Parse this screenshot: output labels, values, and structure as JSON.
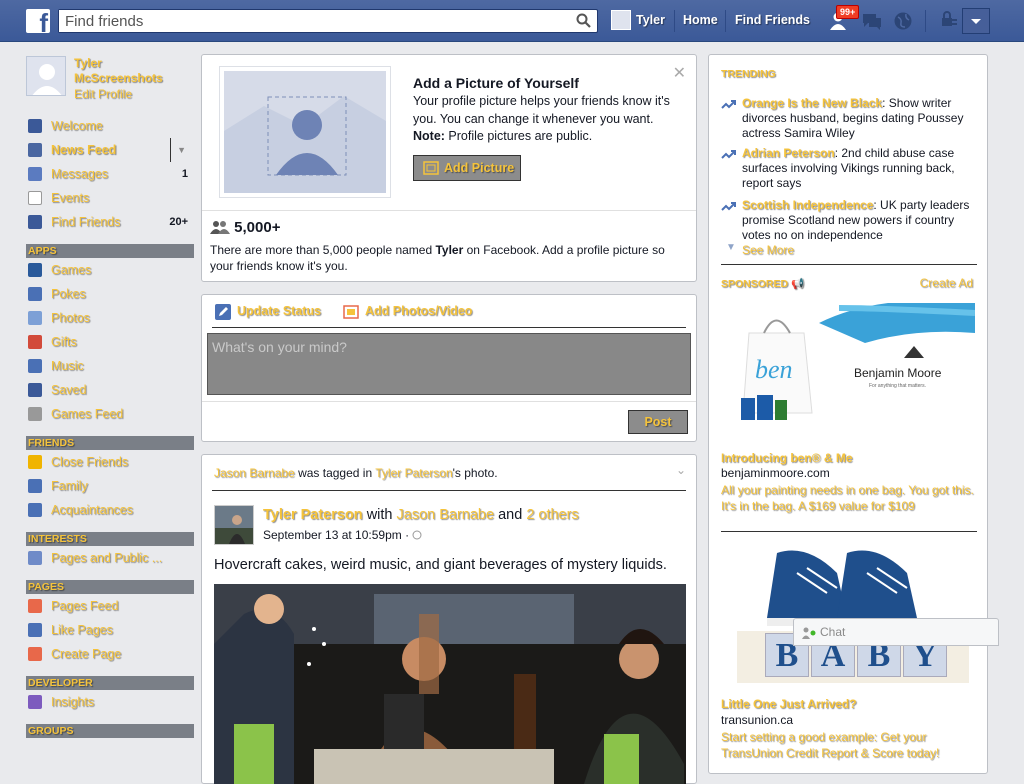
{
  "topbar": {
    "logo": "f",
    "search_placeholder": "Find friends",
    "user_name": "Tyler",
    "home": "Home",
    "find_friends": "Find Friends",
    "notif_badge": "99+",
    "accent": "#3b5998"
  },
  "profile": {
    "name": "Tyler McScreenshots",
    "edit": "Edit Profile"
  },
  "nav": {
    "favorites": [
      {
        "label": "Welcome",
        "icon": "facebook-icon",
        "color": "#3b5998"
      },
      {
        "label": "News Feed",
        "icon": "news-feed-icon",
        "color": "#4b67a1"
      },
      {
        "label": "Messages",
        "icon": "messages-icon",
        "color": "#5b7bc0",
        "count": "1"
      },
      {
        "label": "Events",
        "icon": "calendar-icon",
        "color": "#fff"
      },
      {
        "label": "Find Friends",
        "icon": "find-friends-icon",
        "color": "#3b5998",
        "count": "20+"
      }
    ],
    "apps_header": "APPS",
    "apps": [
      {
        "label": "Games",
        "icon": "games-icon",
        "color": "#2a5a9b"
      },
      {
        "label": "Pokes",
        "icon": "pokes-icon",
        "color": "#4a70b5"
      },
      {
        "label": "Photos",
        "icon": "photos-icon",
        "color": "#7da0d6"
      },
      {
        "label": "Gifts",
        "icon": "gifts-icon",
        "color": "#d24a3a"
      },
      {
        "label": "Music",
        "icon": "music-icon",
        "color": "#4a70b5"
      },
      {
        "label": "Saved",
        "icon": "saved-icon",
        "color": "#3b5998"
      },
      {
        "label": "Games Feed",
        "icon": "gamepad-icon",
        "color": "#999"
      }
    ],
    "friends_header": "FRIENDS",
    "friends": [
      {
        "label": "Close Friends",
        "icon": "star-icon",
        "color": "#f0b400"
      },
      {
        "label": "Family",
        "icon": "family-icon",
        "color": "#4a70b5"
      },
      {
        "label": "Acquaintances",
        "icon": "acquaintances-icon",
        "color": "#4a70b5"
      }
    ],
    "interests_header": "INTERESTS",
    "interests": [
      {
        "label": "Pages and Public ...",
        "icon": "rss-icon",
        "color": "#6f8bc8"
      }
    ],
    "pages_header": "PAGES",
    "pages": [
      {
        "label": "Pages Feed",
        "icon": "megaphone-icon",
        "color": "#e8684a"
      },
      {
        "label": "Like Pages",
        "icon": "thumbs-up-icon",
        "color": "#4a70b5"
      },
      {
        "label": "Create Page",
        "icon": "plus-icon",
        "color": "#e8684a"
      }
    ],
    "developer_header": "DEVELOPER",
    "developer": [
      {
        "label": "Insights",
        "icon": "insights-icon",
        "color": "#7d5bbe"
      }
    ],
    "groups_header": "GROUPS"
  },
  "picture_prompt": {
    "title": "Add a Picture of Yourself",
    "text": "Your profile picture helps your friends know it's you. You can change it whenever you want.",
    "note_label": "Note:",
    "note": " Profile pictures are public.",
    "button": "Add Picture",
    "count": "5,000+",
    "count_text_pre": "There are more than 5,000 people named ",
    "count_name": "Tyler",
    "count_text_post": " on Facebook. Add a profile picture so your friends know it's you."
  },
  "composer": {
    "update_status": "Update Status",
    "add_photos": "Add Photos/Video",
    "placeholder": "What's on your mind?",
    "post": "Post"
  },
  "story": {
    "tag_actor": "Jason Barnabe",
    "tag_mid": " was tagged in ",
    "tag_owner": "Tyler Paterson",
    "tag_end": "'s photo.",
    "author": "Tyler Paterson",
    "with": " with ",
    "with_friend": "Jason Barnabe",
    "and": " and ",
    "others": "2 others",
    "date": "September 13 at 10:59pm · ",
    "text": "Hovercraft cakes, weird music, and giant beverages of mystery liquids."
  },
  "right": {
    "trending_header": "TRENDING",
    "trends": [
      {
        "topic": "Orange Is the New Black",
        "text": ": Show writer divorces husband, begins dating Poussey actress Samira Wiley"
      },
      {
        "topic": "Adrian Peterson",
        "text": ": 2nd child abuse case surfaces involving Vikings running back, report says"
      },
      {
        "topic": "Scottish Independence",
        "text": ": UK party leaders promise Scotland new powers if country votes no on independence"
      }
    ],
    "see_more": "See More",
    "sponsored_header": "SPONSORED",
    "create_ad": "Create Ad",
    "ad1": {
      "brand": "Benjamin Moore",
      "tagline": "For anything that matters.",
      "bag_text": "ben",
      "title": "Introducing ben® & Me",
      "url": "benjaminmoore.com",
      "text": "All your painting needs in one bag. You got this. It's in the bag. A $169 value for $109"
    },
    "ad2": {
      "blocks": [
        "B",
        "A",
        "B",
        "Y"
      ],
      "title": "Little One Just Arrived?",
      "url": "transunion.ca",
      "text": "Start setting a good example: Get your TransUnion Credit Report & Score today!"
    }
  },
  "chat": {
    "label": "Chat"
  }
}
